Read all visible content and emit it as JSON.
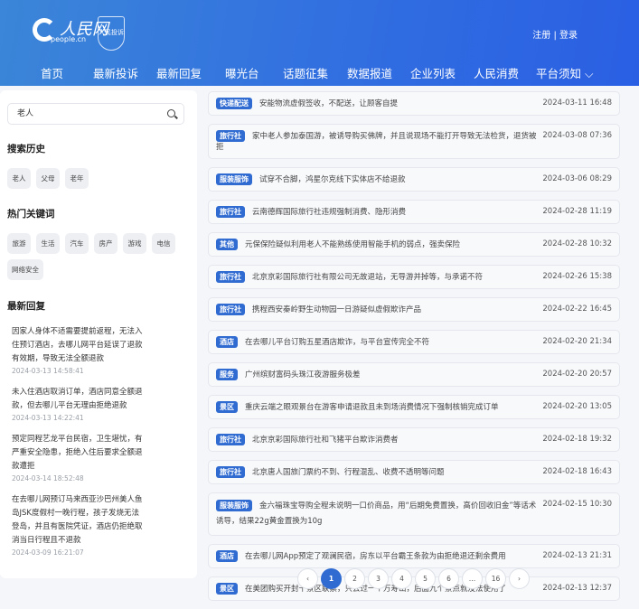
{
  "header": {
    "logo_text": "人民网",
    "logo_sub": "people.cn",
    "badge_text": "人民投诉",
    "auth": "注册 | 登录"
  },
  "nav": [
    "首页",
    "最新投诉",
    "最新回复",
    "曝光台",
    "话题征集",
    "数据报道",
    "企业列表",
    "人民消费",
    "平台须知 ⌵"
  ],
  "sidebar": {
    "search_value": "老人",
    "history_title": "搜索历史",
    "history": [
      "老人",
      "父母",
      "老年"
    ],
    "hot_title": "热门关键词",
    "hot": [
      "旅游",
      "生活",
      "汽车",
      "房产",
      "游戏",
      "电信",
      "网络安全"
    ],
    "replies_title": "最新回复",
    "replies": [
      {
        "text": "因家人身体不适需要提前返程，无法入住预订酒店，去哪儿网平台延误了退款有效期，导致无法全额退款",
        "time": "2024-03-13 14:58:41"
      },
      {
        "text": "未入住酒店取消订单，酒店同意全额退款，但去哪儿平台无理由拒绝退款",
        "time": "2024-03-13 14:22:41"
      },
      {
        "text": "预定同程艺龙平台民宿，卫生堪忧，有严重安全隐患，拒绝入住后要求全额退款遭拒",
        "time": "2024-03-14 18:52:48"
      },
      {
        "text": "在去哪儿网预订马来西亚沙巴州美人鱼岛JSK度假村一晚行程，孩子发烧无法登岛，并且有医院凭证，酒店仍拒绝取消当日行程且不退款",
        "time": "2024-03-09 16:21:07"
      }
    ]
  },
  "complaints": [
    {
      "category": "快递配送",
      "title": "安能物流虚假签收，不配送，让顾客自提",
      "time": "2024-03-11 16:48"
    },
    {
      "category": "旅行社",
      "title": "家中老人参加泰国游，被诱导购买佛牌，并且说现场不能打开导致无法检货，退货被拒",
      "time": "2024-03-08 07:36"
    },
    {
      "category": "服装服饰",
      "title": "试穿不合脚，鸿星尔克线下实体店不给退款",
      "time": "2024-03-06 08:29"
    },
    {
      "category": "旅行社",
      "title": "云南德辉国际旅行社违规强制消费、隐形消费",
      "time": "2024-02-28 11:19"
    },
    {
      "category": "其他",
      "title": "元保保险疑似利用老人不能熟练使用智能手机的弱点，强卖保险",
      "time": "2024-02-28 10:32"
    },
    {
      "category": "旅行社",
      "title": "北京京彩国际旅行社有限公司无故退站，无导游并掉等，与承诺不符",
      "time": "2024-02-26 15:38"
    },
    {
      "category": "旅行社",
      "title": "携程西安秦岭野生动物园一日游疑似虚假欺诈产品",
      "time": "2024-02-22 16:45"
    },
    {
      "category": "酒店",
      "title": "在去哪儿平台订购五星酒店欺诈，与平台宣传完全不符",
      "time": "2024-02-20 21:34"
    },
    {
      "category": "服务",
      "title": "广州缤财富码头珠江夜游服务极差",
      "time": "2024-02-20 20:57"
    },
    {
      "category": "景区",
      "title": "重庆云端之眼观景台在游客申请退款且未到场消费情况下强制核销完成订单",
      "time": "2024-02-20 13:05"
    },
    {
      "category": "旅行社",
      "title": "北京京彩国际旅行社和飞猪平台欺诈消费者",
      "time": "2024-02-18 19:32"
    },
    {
      "category": "旅行社",
      "title": "北京唐人国旅门票约不到、行程混乱、收费不透明等问题",
      "time": "2024-02-18 16:43"
    },
    {
      "category": "服装服饰",
      "title": "金六福珠宝导购全程未说明一口价商品，用“后期免费置换，高价回收旧金”等话术诱导，结果22g黄金置换为10g",
      "time": "2024-02-15 10:30",
      "tall": true
    },
    {
      "category": "酒店",
      "title": "在去哪儿网App预定了观澜民宿，房东以平台霸王条款为由拒绝退还剩余费用",
      "time": "2024-02-13 21:31"
    },
    {
      "category": "景区",
      "title": "在美团购买开封十景区联票，只去过一个万寿山，后面九个景点就没法使用了",
      "time": "2024-02-13 12:37"
    }
  ],
  "pagination": {
    "prev": "‹",
    "pages": [
      "1",
      "2",
      "3",
      "4",
      "5",
      "6",
      "…",
      "16"
    ],
    "current": "1",
    "next": "›"
  },
  "colors": {
    "accent": "#2f6bd1",
    "header_start": "#3b86d8",
    "header_end": "#2a5fe3"
  }
}
